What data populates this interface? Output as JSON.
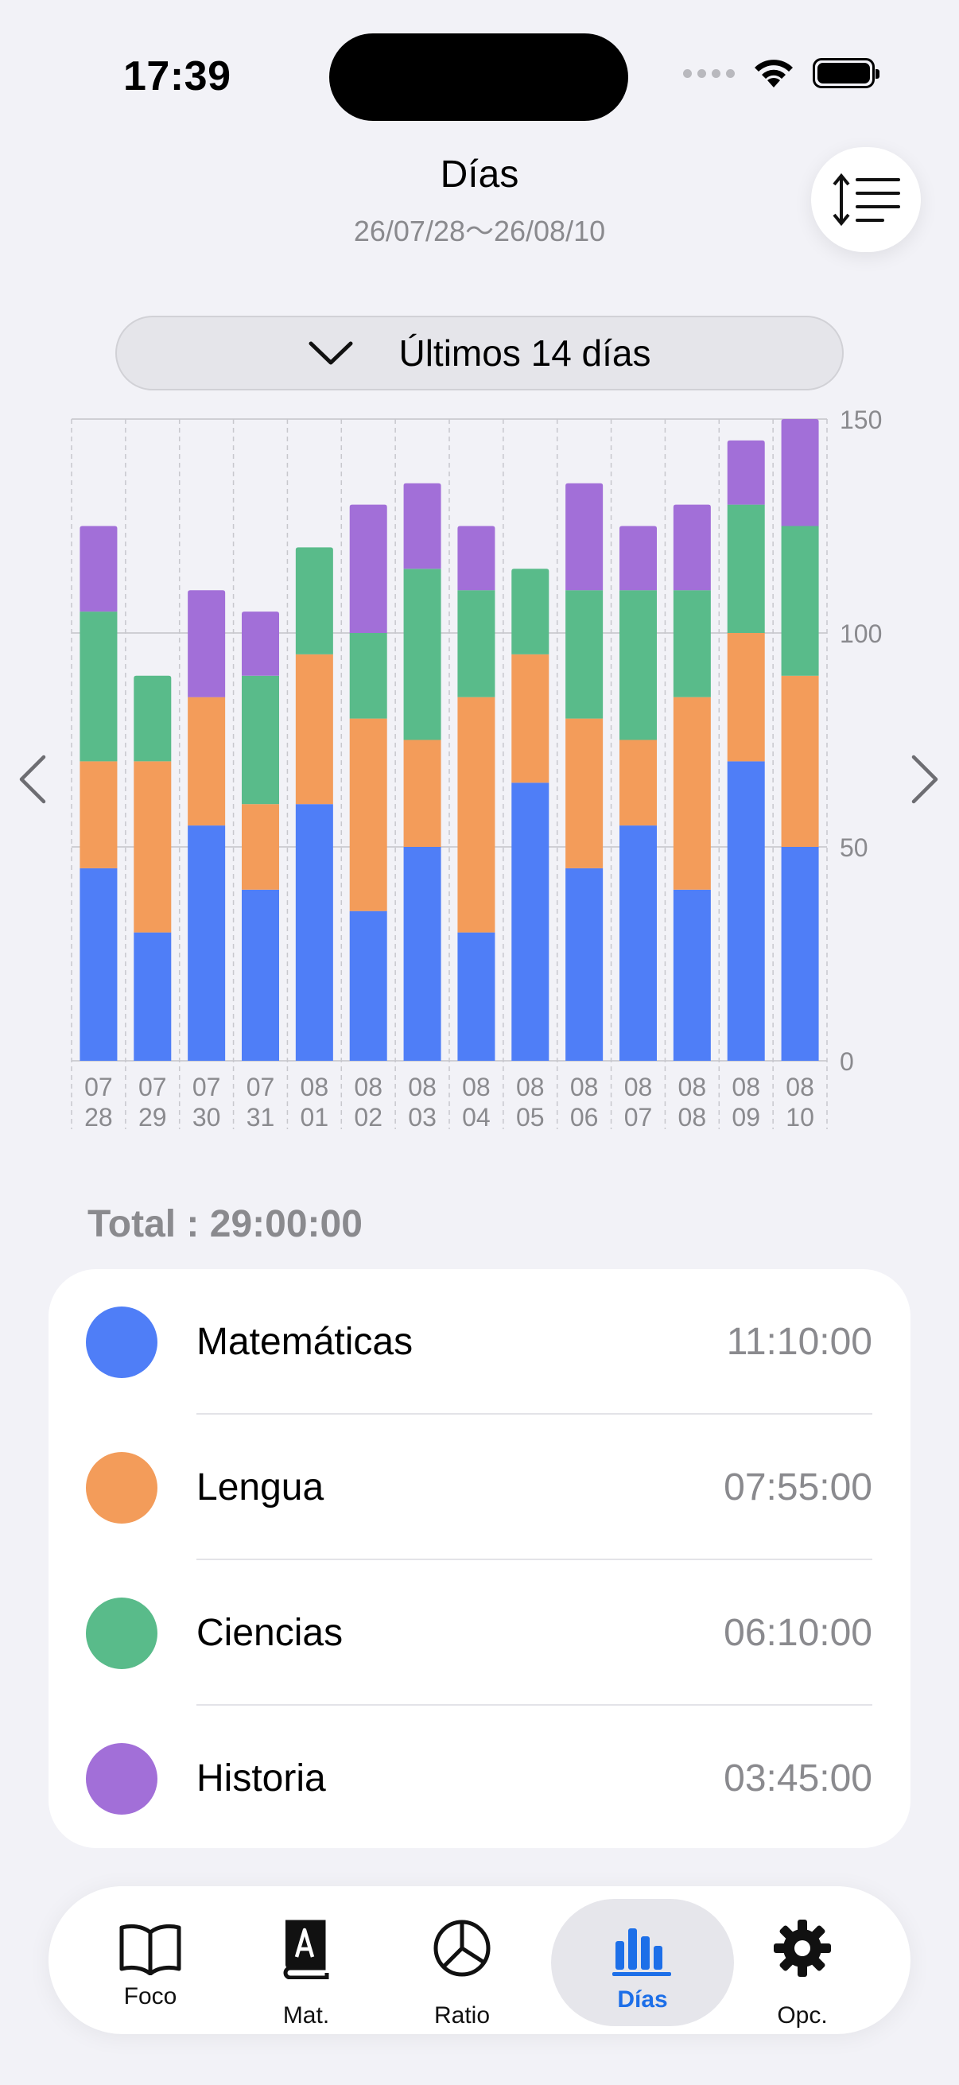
{
  "status_bar": {
    "time": "17:39"
  },
  "header": {
    "title": "Días",
    "range": "26/07/28〜26/08/10"
  },
  "period_selector": {
    "label": "Últimos 14 días"
  },
  "chart_data": {
    "type": "bar",
    "stacked": true,
    "categories": [
      "07 28",
      "07 29",
      "07 30",
      "07 31",
      "08 01",
      "08 02",
      "08 03",
      "08 04",
      "08 05",
      "08 06",
      "08 07",
      "08 08",
      "08 09",
      "08 10"
    ],
    "category_lines": [
      [
        "07",
        "28"
      ],
      [
        "07",
        "29"
      ],
      [
        "07",
        "30"
      ],
      [
        "07",
        "31"
      ],
      [
        "08",
        "01"
      ],
      [
        "08",
        "02"
      ],
      [
        "08",
        "03"
      ],
      [
        "08",
        "04"
      ],
      [
        "08",
        "05"
      ],
      [
        "08",
        "06"
      ],
      [
        "08",
        "07"
      ],
      [
        "08",
        "08"
      ],
      [
        "08",
        "09"
      ],
      [
        "08",
        "10"
      ]
    ],
    "series": [
      {
        "name": "Matemáticas",
        "color": "#4f7ef7",
        "values": [
          45,
          30,
          55,
          40,
          60,
          35,
          50,
          30,
          65,
          45,
          55,
          40,
          70,
          50
        ]
      },
      {
        "name": "Lengua",
        "color": "#f39c5a",
        "values": [
          25,
          40,
          30,
          20,
          35,
          45,
          25,
          55,
          30,
          35,
          20,
          45,
          30,
          40
        ]
      },
      {
        "name": "Ciencias",
        "color": "#59bb8a",
        "values": [
          35,
          20,
          0,
          30,
          25,
          20,
          40,
          25,
          20,
          30,
          35,
          25,
          30,
          35
        ]
      },
      {
        "name": "Historia",
        "color": "#a26fd8",
        "values": [
          20,
          0,
          25,
          15,
          0,
          30,
          20,
          15,
          0,
          25,
          15,
          20,
          15,
          25
        ]
      }
    ],
    "ylim": [
      0,
      150
    ],
    "yticks": [
      "0",
      "50",
      "100",
      "150"
    ],
    "ytick_values": [
      0,
      50,
      100,
      150
    ],
    "grid": true
  },
  "summary": {
    "total": "Total : 29:00:00",
    "items": [
      {
        "name": "Matemáticas",
        "time": "11:10:00",
        "color": "#4f7ef7"
      },
      {
        "name": "Lengua",
        "time": "07:55:00",
        "color": "#f39c5a"
      },
      {
        "name": "Ciencias",
        "time": "06:10:00",
        "color": "#59bb8a"
      },
      {
        "name": "Historia",
        "time": "03:45:00",
        "color": "#a26fd8"
      }
    ]
  },
  "tabbar": {
    "tabs": [
      {
        "label": "Foco",
        "icon": "book-open-icon"
      },
      {
        "label": "Mat.",
        "icon": "dictionary-icon"
      },
      {
        "label": "Ratio",
        "icon": "pie-chart-icon"
      },
      {
        "label": "Días",
        "icon": "bar-chart-icon",
        "active": true
      },
      {
        "label": "Opc.",
        "icon": "gear-icon"
      }
    ]
  }
}
